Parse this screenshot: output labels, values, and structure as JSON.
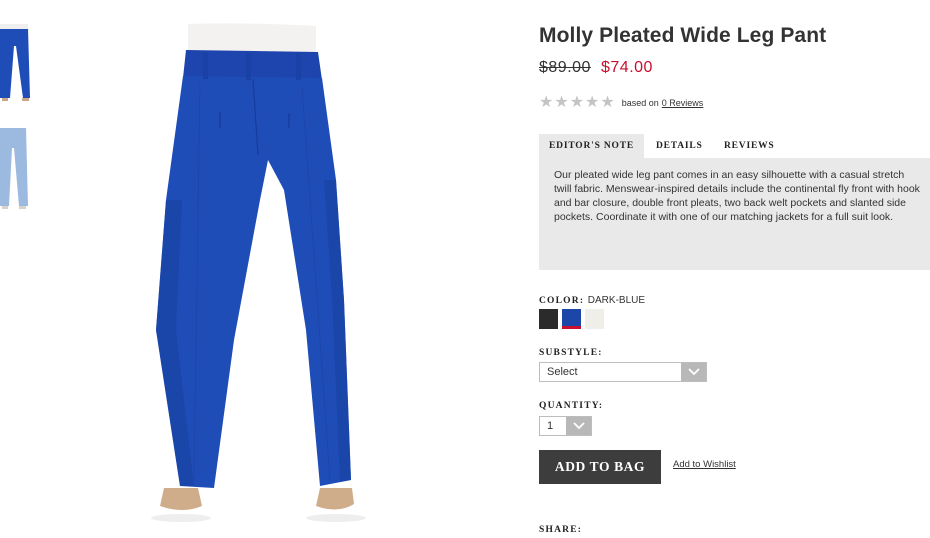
{
  "product": {
    "title": "Molly Pleated Wide Leg Pant",
    "old_price": "$89.00",
    "new_price": "$74.00",
    "rating": {
      "stars_filled": 0,
      "stars_total": 5,
      "based_on": "based on",
      "reviews_link": "0 Reviews"
    }
  },
  "tabs": [
    {
      "label": "EDITOR'S NOTE",
      "active": true
    },
    {
      "label": "DETAILS",
      "active": false
    },
    {
      "label": "REVIEWS",
      "active": false
    }
  ],
  "editors_note": "Our pleated wide leg pant comes in an easy silhouette with a casual stretch twill fabric. Menswear-inspired details include the continental fly front with hook and bar closure, double front pleats, two back welt pockets and slanted side pockets. Coordinate it with one of our matching jackets for a full suit look.",
  "color": {
    "label": "COLOR:",
    "value": "DARK-BLUE",
    "swatches": [
      {
        "name": "black",
        "hex": "#2b2b2b",
        "selected": false
      },
      {
        "name": "dark-blue",
        "hex": "#1c47a8",
        "selected": true
      },
      {
        "name": "ivory",
        "hex": "#efeee8",
        "selected": false
      }
    ]
  },
  "substyle": {
    "label": "SUBSTYLE:",
    "selected": "Select"
  },
  "quantity": {
    "label": "QUANTITY:",
    "selected": "1"
  },
  "actions": {
    "add_to_bag": "ADD TO BAG",
    "add_to_wishlist": "Add to Wishlist"
  },
  "share": {
    "label": "SHARE:"
  },
  "colors": {
    "accent": "#c8102e",
    "button": "#3d3d3d",
    "panel": "#e9e9e9",
    "pant_blue": "#1f4db8",
    "pant_light_blue": "#9cb9e0"
  },
  "icons": {
    "star": "star-icon",
    "dropdown": "chevron-down-icon"
  }
}
